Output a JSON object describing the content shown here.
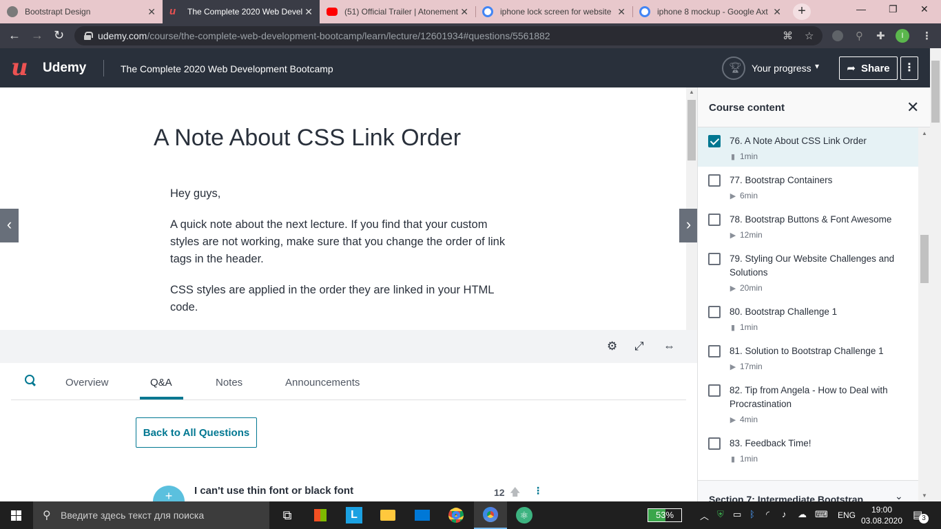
{
  "browser": {
    "tabs": [
      {
        "title": "Bootstrapt Design",
        "color": "#7a7a7a"
      },
      {
        "title": "The Complete 2020 Web Devel",
        "color": "#ec5252"
      },
      {
        "title": "(51) Official Trailer | Atonement",
        "color": "#ff0000"
      },
      {
        "title": "iphone lock screen for website",
        "color": "#4285f4"
      },
      {
        "title": "iphone 8 mockup - Google Axt",
        "color": "#4285f4"
      }
    ],
    "url_host": "udemy.com",
    "url_path": "/course/the-complete-web-development-bootcamp/learn/lecture/12601934#questions/5561882",
    "profile_initial": "I"
  },
  "header": {
    "logo_text": "Udemy",
    "course_title": "The Complete 2020 Web Development Bootcamp",
    "progress_label": "Your progress",
    "share_label": "Share"
  },
  "lecture": {
    "title": "A Note About CSS Link Order",
    "paragraphs": [
      "Hey guys,",
      "A quick note about the next lecture. If you find that your custom styles are not working, make sure that you change the order of link tags in the header.",
      "CSS styles are applied in the order they are linked in your HTML code."
    ]
  },
  "tabs": {
    "overview": "Overview",
    "qa": "Q&A",
    "notes": "Notes",
    "announcements": "Announcements"
  },
  "qa": {
    "back_label": "Back to All Questions",
    "question_title": "I can't use thin font or black font",
    "votes": "12"
  },
  "sidebar": {
    "title": "Course content",
    "items": [
      {
        "name": "76. A Note About CSS Link Order",
        "duration": "1min",
        "kind": "doc",
        "checked": true
      },
      {
        "name": "77. Bootstrap Containers",
        "duration": "6min",
        "kind": "video",
        "checked": false
      },
      {
        "name": "78. Bootstrap Buttons & Font Awesome",
        "duration": "12min",
        "kind": "video",
        "checked": false
      },
      {
        "name": "79. Styling Our Website Challenges and Solutions",
        "duration": "20min",
        "kind": "video",
        "checked": false
      },
      {
        "name": "80. Bootstrap Challenge 1",
        "duration": "1min",
        "kind": "doc",
        "checked": false
      },
      {
        "name": "81. Solution to Bootstrap Challenge 1",
        "duration": "17min",
        "kind": "video",
        "checked": false
      },
      {
        "name": "82. Tip from Angela - How to Deal with Procrastination",
        "duration": "4min",
        "kind": "video",
        "checked": false
      },
      {
        "name": "83. Feedback Time!",
        "duration": "1min",
        "kind": "doc",
        "checked": false
      }
    ],
    "next_section": "Section 7: Intermediate Bootstrap"
  },
  "taskbar": {
    "search_placeholder": "Введите здесь текст для поиска",
    "battery": "53%",
    "battery_level": 0.53,
    "language": "ENG",
    "time": "19:00",
    "date": "03.08.2020",
    "notifications": "3"
  },
  "colors": {
    "udemy_red": "#ec5252",
    "udemy_teal": "#007791",
    "header_bg": "#29303b"
  }
}
